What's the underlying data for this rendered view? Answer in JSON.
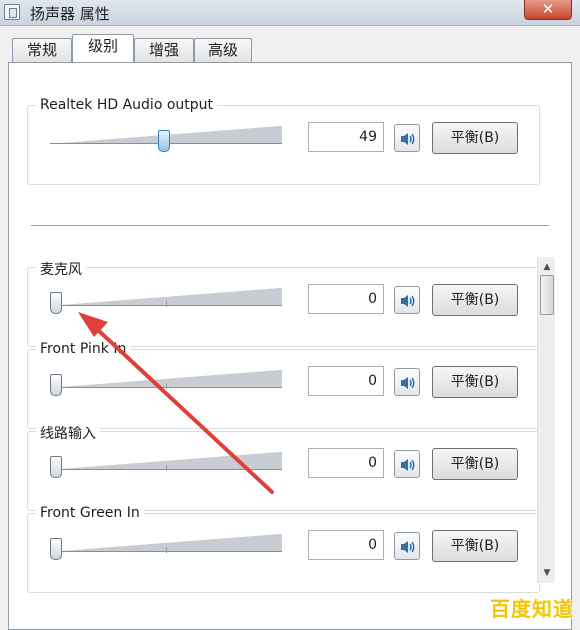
{
  "window": {
    "title": "扬声器 属性",
    "close_label": "✕"
  },
  "tabs": [
    {
      "label": "常规",
      "active": false
    },
    {
      "label": "级别",
      "active": true
    },
    {
      "label": "增强",
      "active": false
    },
    {
      "label": "高级",
      "active": false
    }
  ],
  "main_output": {
    "label": "Realtek HD Audio output",
    "value": "49",
    "level_percent": 49,
    "balance_label": "平衡(B)"
  },
  "inputs": [
    {
      "label": "麦克风",
      "value": "0",
      "level_percent": 0,
      "balance_label": "平衡(B)"
    },
    {
      "label": "Front Pink In",
      "value": "0",
      "level_percent": 0,
      "balance_label": "平衡(B)"
    },
    {
      "label": "线路输入",
      "value": "0",
      "level_percent": 0,
      "balance_label": "平衡(B)"
    },
    {
      "label": "Front Green In",
      "value": "0",
      "level_percent": 0,
      "balance_label": "平衡(B)"
    }
  ],
  "scrollbar": {
    "up_glyph": "▲",
    "down_glyph": "▼"
  },
  "icons": {
    "speaker": "speaker-volume-icon",
    "window": "speaker-properties-icon",
    "annotation": "red-arrow-annotation"
  },
  "colors": {
    "annotation": "#e0403a",
    "watermark": "#f2c600",
    "thumb_active": "#8fc4e8"
  },
  "watermark": "百度知道"
}
